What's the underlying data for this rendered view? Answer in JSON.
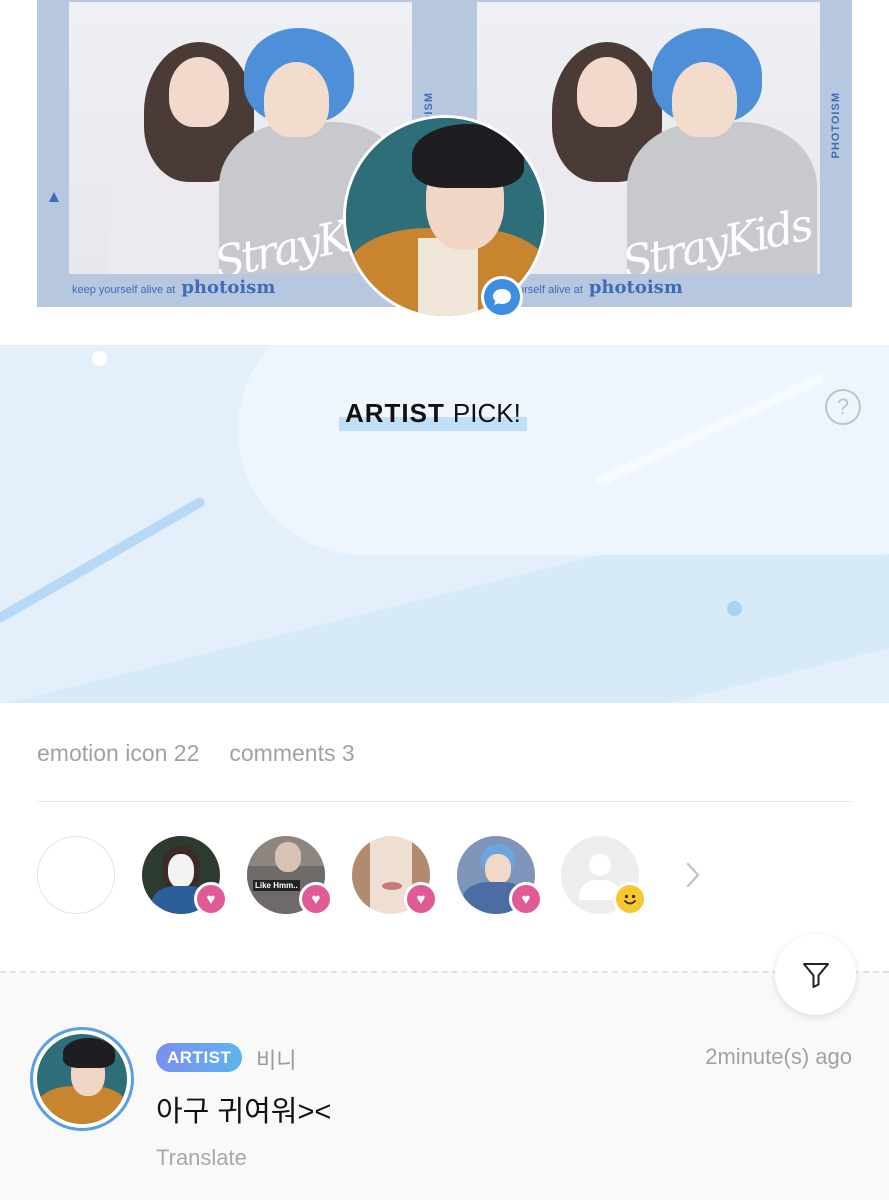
{
  "photo_strip": {
    "frames": [
      {
        "footer_small": "keep yourself alive at",
        "brand": "photoism",
        "side_label": "PHOTOISM",
        "signature": "StrayKids"
      },
      {
        "footer_small": "keep yourself alive at",
        "brand": "photoism",
        "side_label": "PHOTOISM",
        "signature": "StrayKids"
      }
    ]
  },
  "artist_pick": {
    "title_bold": "ARTIST",
    "title_rest": "PICK!",
    "help_symbol": "?",
    "avatar_icon": "artist-avatar",
    "badge_icon": "chat-bubble-icon"
  },
  "stats": {
    "emotion": "emotion icon 22",
    "comments": "comments 3"
  },
  "reactors": [
    {
      "type": "empty"
    },
    {
      "type": "photo",
      "badge": "heart-icon",
      "overlay_text": ""
    },
    {
      "type": "photo",
      "badge": "heart-icon",
      "overlay_text": "Like Hmm.."
    },
    {
      "type": "photo",
      "badge": "heart-icon",
      "overlay_text": ""
    },
    {
      "type": "photo",
      "badge": "heart-icon",
      "overlay_text": ""
    },
    {
      "type": "default",
      "badge": "smile-icon",
      "overlay_text": ""
    }
  ],
  "comment": {
    "badge": "ARTIST",
    "name": "비니",
    "time": "2minute(s) ago",
    "text": "아구 귀여워><",
    "translate": "Translate"
  },
  "colors": {
    "accent_blue": "#3b8ee0",
    "heart_pink": "#e05b95",
    "banner_bg": "#e3f0fb"
  }
}
